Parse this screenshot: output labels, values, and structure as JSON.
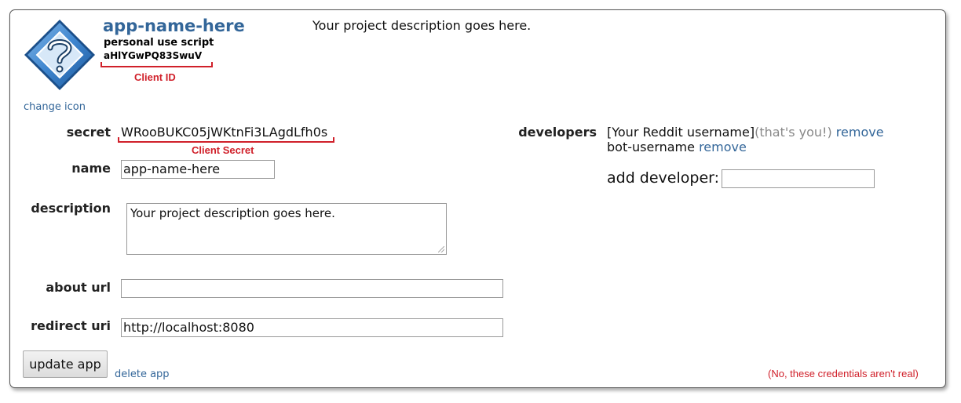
{
  "app": {
    "name": "app-name-here",
    "type": "personal use script",
    "client_id": "aHlYGwPQ83SwuV",
    "header_description": "Your project description goes here.",
    "change_icon_label": "change icon",
    "icon": "question-mark-diamond-icon"
  },
  "annotations": {
    "client_id_label": "Client ID",
    "client_secret_label": "Client Secret",
    "disclaimer": "(No, these credentials aren't real)",
    "color": "#d0202a"
  },
  "form": {
    "secret_label": "secret",
    "secret_value": "WRooBUKC05jWKtnFi3LAgdLfh0s",
    "name_label": "name",
    "name_value": "app-name-here",
    "description_label": "description",
    "description_value": "Your project description goes here.",
    "about_url_label": "about url",
    "about_url_value": "",
    "redirect_uri_label": "redirect uri",
    "redirect_uri_value": "http://localhost:8080"
  },
  "developers": {
    "label": "developers",
    "list": [
      {
        "name": "[Your Reddit username]",
        "note": "(that's you!)",
        "remove_label": "remove"
      },
      {
        "name": "bot-username",
        "note": "",
        "remove_label": "remove"
      }
    ],
    "add_label": "add developer:",
    "add_value": ""
  },
  "actions": {
    "update_label": "update app",
    "delete_label": "delete app"
  },
  "colors": {
    "link": "#336699",
    "border": "#555555"
  }
}
